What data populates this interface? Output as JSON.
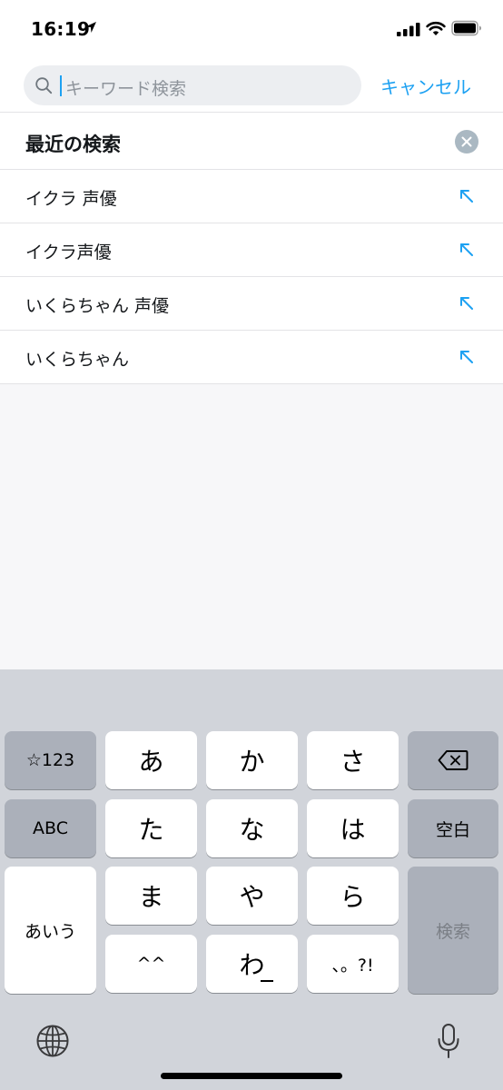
{
  "status_bar": {
    "time": "16:19"
  },
  "search": {
    "placeholder": "キーワード検索",
    "cancel_label": "キャンセル"
  },
  "recent": {
    "title": "最近の検索",
    "items": [
      {
        "label": "イクラ 声優"
      },
      {
        "label": "イクラ声優"
      },
      {
        "label": "いくらちゃん 声優"
      },
      {
        "label": "いくらちゃん"
      }
    ]
  },
  "keyboard": {
    "numbers_key": "☆123",
    "abc_key": "ABC",
    "aiu_key": "あいう",
    "space_key": "空白",
    "search_key": "検索",
    "row1": [
      "あ",
      "か",
      "さ"
    ],
    "row2": [
      "た",
      "な",
      "は"
    ],
    "row3": [
      "ま",
      "や",
      "ら"
    ],
    "row4": [
      "^^",
      "わ",
      "、。?!"
    ]
  },
  "icons": {
    "location": "location-arrow-icon",
    "signal": "cellular-signal-icon",
    "wifi": "wifi-icon",
    "battery": "battery-icon",
    "search": "search-icon",
    "clear": "clear-circle-icon",
    "fill": "arrow-up-left-icon",
    "delete": "delete-backspace-icon",
    "globe": "globe-icon",
    "mic": "microphone-icon"
  },
  "colors": {
    "accent": "#1da1f2",
    "keyboard_bg": "#d1d4da",
    "clear_button": "#aab8c2"
  }
}
